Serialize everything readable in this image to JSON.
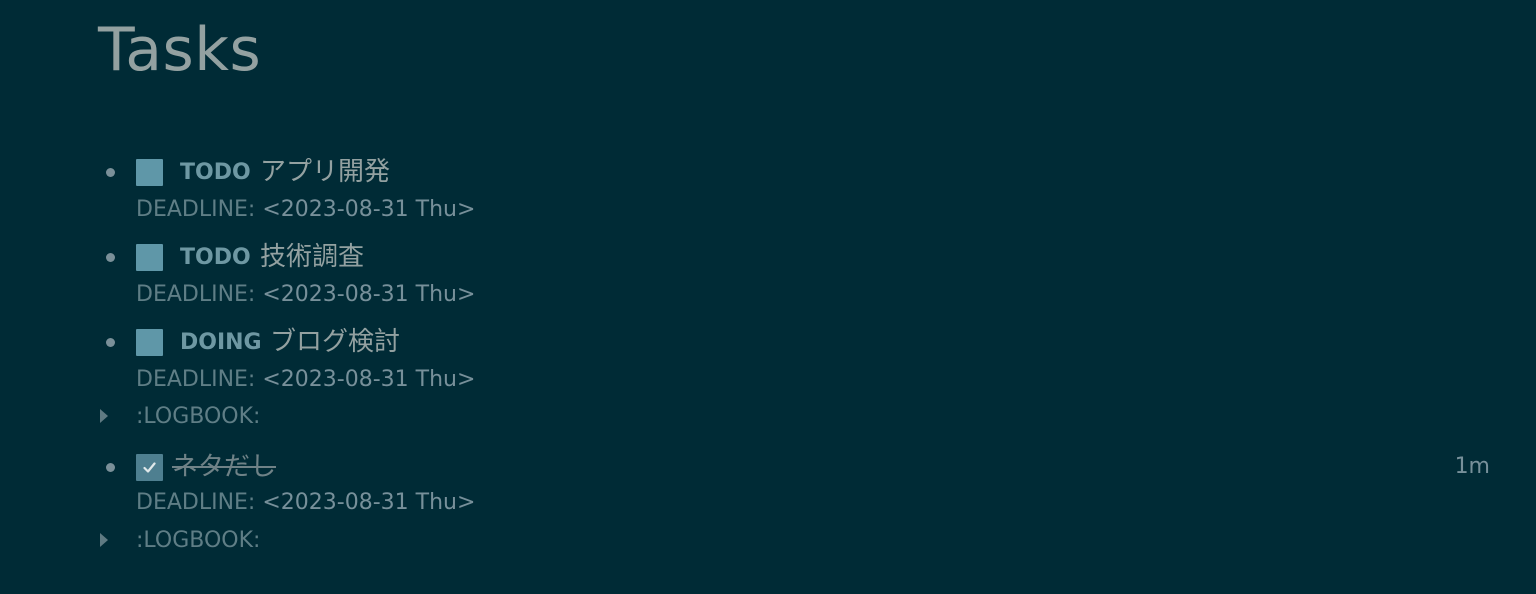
{
  "page": {
    "title": "Tasks"
  },
  "tasks": [
    {
      "marker": "TODO",
      "title": "アプリ開発",
      "deadline_label": "DEADLINE:",
      "deadline_date": "<2023-08-31 Thu>"
    },
    {
      "marker": "TODO",
      "title": "技術調査",
      "deadline_label": "DEADLINE:",
      "deadline_date": "<2023-08-31 Thu>"
    },
    {
      "marker": "DOING",
      "title": "ブログ検討",
      "deadline_label": "DEADLINE:",
      "deadline_date": "<2023-08-31 Thu>",
      "logbook": ":LOGBOOK:"
    },
    {
      "title": "ネタだし",
      "done": true,
      "duration": "1m",
      "deadline_label": "DEADLINE:",
      "deadline_date": "<2023-08-31 Thu>",
      "logbook": ":LOGBOOK:"
    }
  ],
  "colors": {
    "background": "#002b36",
    "text": "#93a1a1",
    "checkbox": "#5f97a8",
    "marker": "#6e98a3"
  }
}
